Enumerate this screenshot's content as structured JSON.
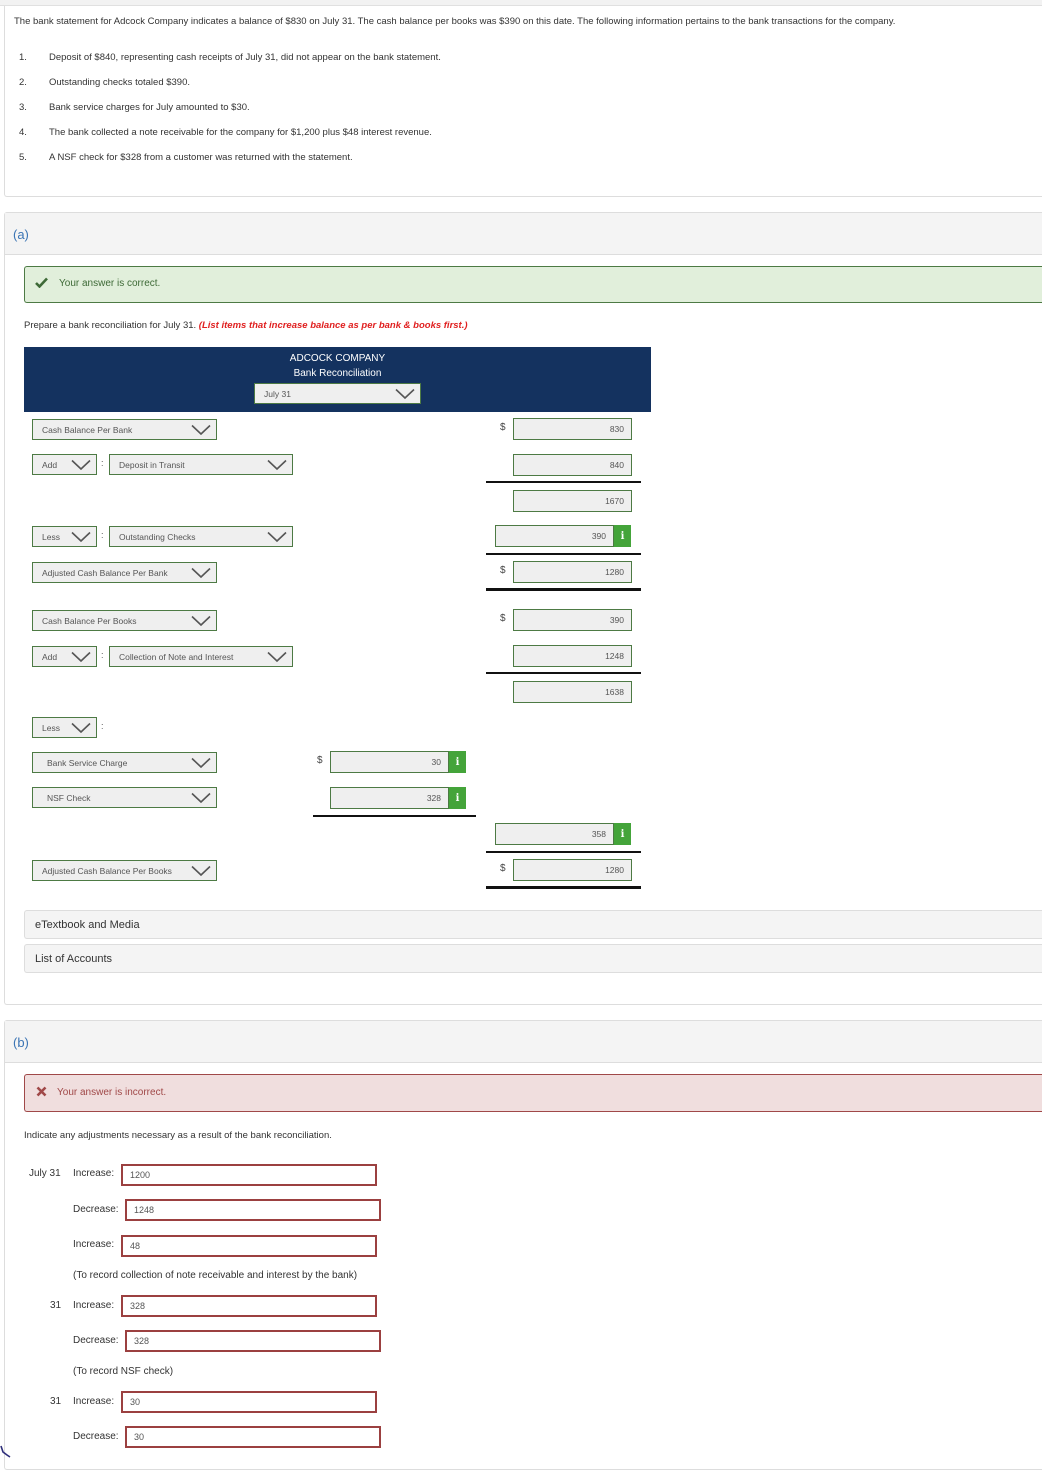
{
  "problem": {
    "intro": "The bank statement for Adcock Company indicates a balance of $830 on July 31. The cash balance per books was $390 on this date. The following information pertains to the bank transactions for the company.",
    "items": [
      {
        "num": "1.",
        "text": "Deposit of $840, representing cash receipts of July 31, did not appear on the bank statement."
      },
      {
        "num": "2.",
        "text": "Outstanding checks totaled $390."
      },
      {
        "num": "3.",
        "text": "Bank service charges for July amounted to $30."
      },
      {
        "num": "4.",
        "text": "The bank collected a note receivable for the company for $1,200 plus $48 interest revenue."
      },
      {
        "num": "5.",
        "text": "A NSF check for $328 from a customer was returned with the statement."
      }
    ]
  },
  "part_a": {
    "label": "(a)",
    "feedback": "Your answer is correct.",
    "instruction": "Prepare a bank reconciliation for July 31.",
    "instruction_emphasis": "(List items that increase balance as per bank & books first.)",
    "header": {
      "company": "ADCOCK COMPANY",
      "title": "Bank Reconciliation",
      "date": "July 31"
    },
    "currency": "$",
    "rows": {
      "cash_per_bank": {
        "label": "Cash Balance Per Bank",
        "amount": "830"
      },
      "bank_add": {
        "op": "Add",
        "label": "Deposit in Transit",
        "amount": "840"
      },
      "bank_subtotal": {
        "amount": "1670"
      },
      "bank_less": {
        "op": "Less",
        "label": "Outstanding Checks",
        "amount": "390"
      },
      "adj_bank": {
        "label": "Adjusted Cash Balance Per Bank",
        "amount": "1280"
      },
      "cash_per_books": {
        "label": "Cash Balance Per Books",
        "amount": "390"
      },
      "books_add": {
        "op": "Add",
        "label": "Collection of Note and Interest",
        "amount": "1248"
      },
      "books_subtotal": {
        "amount": "1638"
      },
      "books_less": {
        "op": "Less",
        "label": ""
      },
      "books_less_item1": {
        "label": "Bank Service Charge",
        "amount": "30"
      },
      "books_less_item2": {
        "label": "NSF Check",
        "amount": "328"
      },
      "books_less_total": {
        "amount": "358"
      },
      "adj_books": {
        "label": "Adjusted Cash Balance Per Books",
        "amount": "1280"
      }
    },
    "info_icon": "i",
    "links": [
      "eTextbook and Media",
      "List of Accounts"
    ]
  },
  "part_b": {
    "label": "(b)",
    "feedback": "Your answer is incorrect.",
    "instruction": "Indicate any adjustments necessary as a result of the bank reconciliation.",
    "entries": [
      {
        "date": "July 31",
        "label": "Increase:",
        "value": "1200"
      },
      {
        "date": "",
        "label": "Decrease:",
        "value": "1248"
      },
      {
        "date": "",
        "label": "Increase:",
        "value": "48"
      },
      {
        "note": "(To record collection of note receivable and interest by the bank)"
      },
      {
        "date": "31",
        "label": "Increase:",
        "value": "328"
      },
      {
        "date": "",
        "label": "Decrease:",
        "value": "328"
      },
      {
        "note": "(To record NSF check)"
      },
      {
        "date": "31",
        "label": "Increase:",
        "value": "30"
      },
      {
        "date": "",
        "label": "Decrease:",
        "value": "30"
      }
    ]
  }
}
